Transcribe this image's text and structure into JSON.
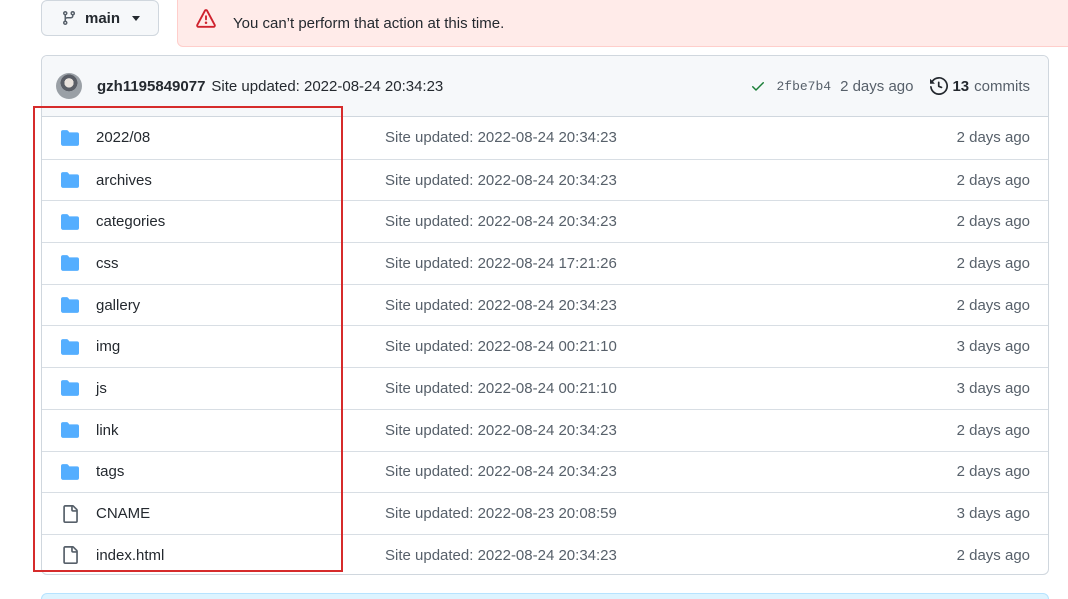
{
  "branch": {
    "label": "main",
    "icon": "git-branch-icon"
  },
  "flash": {
    "message": "You can’t perform that action at this time.",
    "icon": "alert-icon",
    "color": "#cf222e"
  },
  "header": {
    "author": "gzh1195849077",
    "message": "Site updated: 2022-08-24 20:34:23",
    "sha": "2fbe7b4",
    "age": "2 days ago",
    "commits_count": "13",
    "commits_label": "commits"
  },
  "files": [
    {
      "type": "folder",
      "name": "2022/08",
      "message": "Site updated: 2022-08-24 20:34:23",
      "age": "2 days ago"
    },
    {
      "type": "folder",
      "name": "archives",
      "message": "Site updated: 2022-08-24 20:34:23",
      "age": "2 days ago"
    },
    {
      "type": "folder",
      "name": "categories",
      "message": "Site updated: 2022-08-24 20:34:23",
      "age": "2 days ago"
    },
    {
      "type": "folder",
      "name": "css",
      "message": "Site updated: 2022-08-24 17:21:26",
      "age": "2 days ago"
    },
    {
      "type": "folder",
      "name": "gallery",
      "message": "Site updated: 2022-08-24 20:34:23",
      "age": "2 days ago"
    },
    {
      "type": "folder",
      "name": "img",
      "message": "Site updated: 2022-08-24 00:21:10",
      "age": "3 days ago"
    },
    {
      "type": "folder",
      "name": "js",
      "message": "Site updated: 2022-08-24 00:21:10",
      "age": "3 days ago"
    },
    {
      "type": "folder",
      "name": "link",
      "message": "Site updated: 2022-08-24 20:34:23",
      "age": "2 days ago"
    },
    {
      "type": "folder",
      "name": "tags",
      "message": "Site updated: 2022-08-24 20:34:23",
      "age": "2 days ago"
    },
    {
      "type": "file",
      "name": "CNAME",
      "message": "Site updated: 2022-08-23 20:08:59",
      "age": "3 days ago"
    },
    {
      "type": "file",
      "name": "index.html",
      "message": "Site updated: 2022-08-24 20:34:23",
      "age": "2 days ago"
    }
  ],
  "colors": {
    "folder": "#54aeff",
    "file": "#57606a",
    "check": "#1a7f37",
    "highlight": "#d62b2b"
  }
}
